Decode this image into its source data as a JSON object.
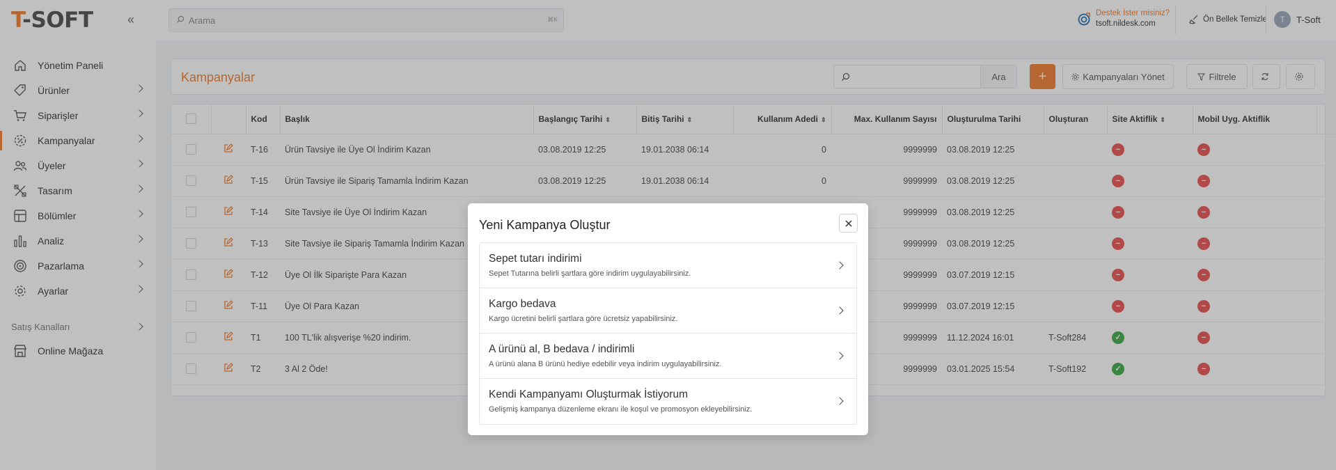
{
  "brand": {
    "logo_t": "T",
    "logo_rest": "-SOFT"
  },
  "header": {
    "search_placeholder": "Arama",
    "search_kbd": "⌘K",
    "support_question": "Destek İster misiniz?",
    "support_email": "tsoft.nildesk.com",
    "clear_cache": "Ön Bellek Temizle",
    "user_initial": "T",
    "user_name": "T-Soft"
  },
  "sidebar": {
    "items": [
      {
        "label": "Yönetim Paneli",
        "icon": "home-icon"
      },
      {
        "label": "Ürünler",
        "icon": "tag-icon"
      },
      {
        "label": "Siparişler",
        "icon": "cart-icon"
      },
      {
        "label": "Kampanyalar",
        "icon": "campaign-icon",
        "active": true
      },
      {
        "label": "Üyeler",
        "icon": "users-icon"
      },
      {
        "label": "Tasarım",
        "icon": "design-icon"
      },
      {
        "label": "Bölümler",
        "icon": "sections-icon"
      },
      {
        "label": "Analiz",
        "icon": "chart-icon"
      },
      {
        "label": "Pazarlama",
        "icon": "target-icon"
      },
      {
        "label": "Ayarlar",
        "icon": "gear-icon"
      }
    ],
    "section_title": "Satış Kanalları",
    "channel": "Online Mağaza"
  },
  "page": {
    "title": "Kampanyalar",
    "search_button": "Ara",
    "add_button": "+",
    "manage_button": "Kampanyaları Yönet",
    "filter_button": "Filtrele"
  },
  "table": {
    "columns": {
      "kod": "Kod",
      "baslik": "Başlık",
      "baslangic": "Başlangıç Tarihi",
      "bitis": "Bitiş Tarihi",
      "kullanim": "Kullanım Adedi",
      "max": "Max. Kullanım Sayısı",
      "olusturulma": "Oluşturulma Tarihi",
      "olusturan": "Oluşturan",
      "site": "Site Aktiflik",
      "mobil": "Mobil Uyg. Aktiflik",
      "hash": "#"
    },
    "rows": [
      {
        "kod": "T-16",
        "baslik": "Ürün Tavsiye ile Üye Ol İndirim Kazan",
        "baslangic": "03.08.2019 12:25",
        "bitis": "19.01.2038 06:14",
        "kullanim": "0",
        "max": "9999999",
        "olusturulma": "03.08.2019 12:25",
        "olusturan": "",
        "site": false,
        "mobil": false
      },
      {
        "kod": "T-15",
        "baslik": "Ürün Tavsiye ile Sipariş Tamamla İndirim Kazan",
        "baslangic": "03.08.2019 12:25",
        "bitis": "19.01.2038 06:14",
        "kullanim": "0",
        "max": "9999999",
        "olusturulma": "03.08.2019 12:25",
        "olusturan": "",
        "site": false,
        "mobil": false
      },
      {
        "kod": "T-14",
        "baslik": "Site Tavsiye ile Üye Ol İndirim Kazan",
        "baslangic": "",
        "bitis": "",
        "kullanim": "",
        "max": "9999999",
        "olusturulma": "03.08.2019 12:25",
        "olusturan": "",
        "site": false,
        "mobil": false
      },
      {
        "kod": "T-13",
        "baslik": "Site Tavsiye ile Sipariş Tamamla İndirim Kazan",
        "baslangic": "",
        "bitis": "",
        "kullanim": "",
        "max": "9999999",
        "olusturulma": "03.08.2019 12:25",
        "olusturan": "",
        "site": false,
        "mobil": false
      },
      {
        "kod": "T-12",
        "baslik": "Üye Ol İlk Siparişte Para Kazan",
        "baslangic": "",
        "bitis": "",
        "kullanim": "",
        "max": "9999999",
        "olusturulma": "03.07.2019 12:15",
        "olusturan": "",
        "site": false,
        "mobil": false
      },
      {
        "kod": "T-11",
        "baslik": "Üye Ol Para Kazan",
        "baslangic": "",
        "bitis": "",
        "kullanim": "",
        "max": "9999999",
        "olusturulma": "03.07.2019 12:15",
        "olusturan": "",
        "site": false,
        "mobil": false
      },
      {
        "kod": "T1",
        "baslik": "100 TL'lik alışverişe %20 indirim.",
        "baslangic": "",
        "bitis": "",
        "kullanim": "",
        "max": "9999999",
        "olusturulma": "11.12.2024 16:01",
        "olusturan": "T-Soft284",
        "site": true,
        "mobil": false
      },
      {
        "kod": "T2",
        "baslik": "3 Al 2 Öde!",
        "baslangic": "",
        "bitis": "",
        "kullanim": "",
        "max": "9999999",
        "olusturulma": "03.01.2025 15:54",
        "olusturan": "T-Soft192",
        "site": true,
        "mobil": false
      }
    ]
  },
  "modal": {
    "title": "Yeni Kampanya Oluştur",
    "options": [
      {
        "title": "Sepet tutarı indirimi",
        "desc": "Sepet Tutarına belirli şartlara göre indirim uygulayabilirsiniz."
      },
      {
        "title": "Kargo bedava",
        "desc": "Kargo ücretini belirli şartlara göre ücretsiz yapabilirsiniz."
      },
      {
        "title": "A ürünü al, B bedava / indirimli",
        "desc": "A ürünü alana B ürünü hediye edebilir veya indirim uygulayabilirsiniz."
      },
      {
        "title": "Kendi Kampanyamı Oluşturmak İstiyorum",
        "desc": "Gelişmiş kampanya düzenleme ekranı ile koşul ve promosyon ekleyebilirsiniz."
      }
    ]
  },
  "colors": {
    "accent": "#f07b2c",
    "inactive": "#e8504f",
    "active": "#3aa845"
  }
}
